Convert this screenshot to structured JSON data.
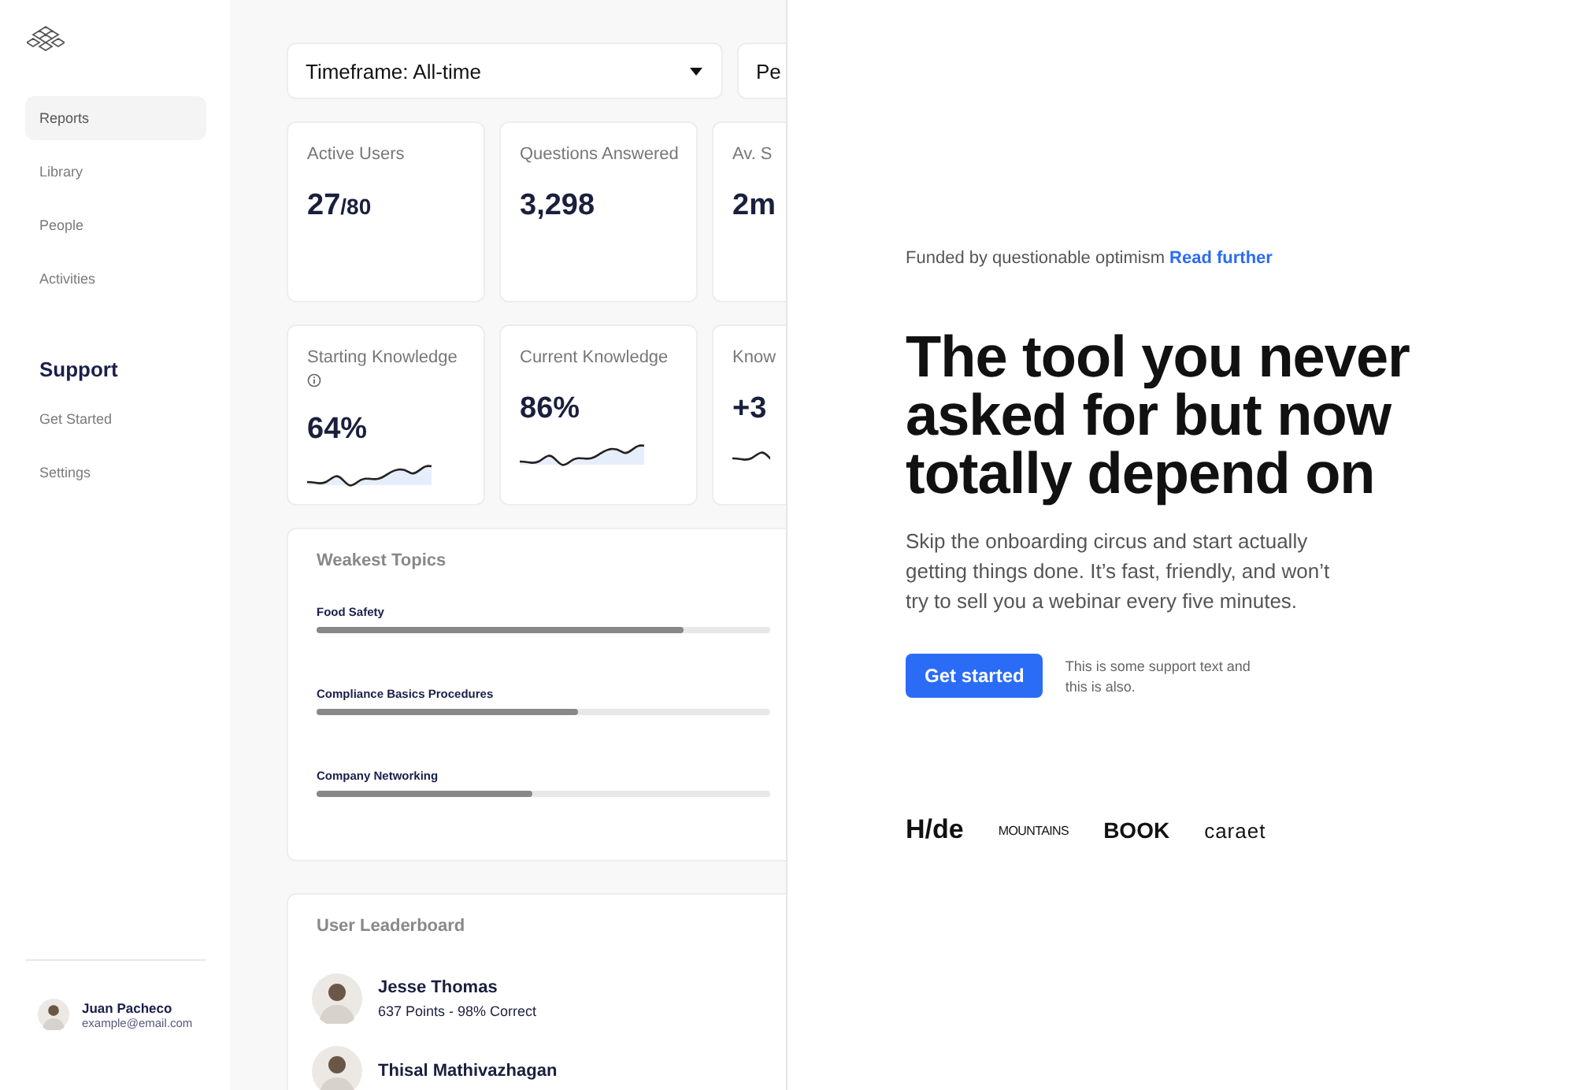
{
  "sidebar": {
    "nav": [
      {
        "label": "Reports",
        "selected": true
      },
      {
        "label": "Library",
        "selected": false
      },
      {
        "label": "People",
        "selected": false
      },
      {
        "label": "Activities",
        "selected": false
      }
    ],
    "support_heading": "Support",
    "support": [
      {
        "label": "Get Started",
        "selected": false
      },
      {
        "label": "Settings",
        "selected": false
      }
    ],
    "user": {
      "name": "Juan Pacheco",
      "email": "example@email.com"
    }
  },
  "filters": [
    {
      "label": "Timeframe: All-time",
      "dropdown": true
    },
    {
      "label": "Pe"
    }
  ],
  "stats": [
    {
      "label": "Active Users",
      "value": "27",
      "suffix": "/80",
      "sparkline": false,
      "info": false
    },
    {
      "label": "Questions Answered",
      "value": "3,298",
      "sparkline": false,
      "info": false
    },
    {
      "label": "Av. S",
      "value": "2m",
      "sparkline": false,
      "info": false
    },
    {
      "label": "Starting Knowledge",
      "value": "64%",
      "sparkline": true,
      "info": true
    },
    {
      "label": "Current Knowledge",
      "value": "86%",
      "sparkline": true,
      "info": false
    },
    {
      "label": "Know",
      "value": "+3",
      "sparkline": true,
      "info": false
    }
  ],
  "weakest": {
    "title": "Weakest Topics",
    "topics": [
      {
        "name": "Food Safety",
        "level": 0.81
      },
      {
        "name": "Compliance Basics Procedures",
        "level": 0.575
      },
      {
        "name": "Company Networking",
        "level": 0.475
      }
    ]
  },
  "leaderboard": {
    "title": "User Leaderboard",
    "users": [
      {
        "name": "Jesse Thomas",
        "detail": "637 Points - 98% Correct"
      },
      {
        "name": "Thisal Mathivazhagan"
      }
    ]
  },
  "hero": {
    "eyebrow": "Funded by questionable optimism",
    "eyebrow_link": "Read further",
    "headline": "The tool you never asked for but now totally depend on",
    "body": "Skip the onboarding circus and start actually getting things done. It’s fast, friendly, and won’t try to sell you a webinar every five minutes.",
    "cta": "Get started",
    "support_text": "This is some support text and this is also.",
    "logos": [
      {
        "kind": "hide",
        "text": "H/de"
      },
      {
        "kind": "mountains",
        "text": "MOUNTAINS"
      },
      {
        "kind": "book",
        "text": "BOOK"
      },
      {
        "kind": "caraet",
        "text": "caraet"
      }
    ]
  }
}
